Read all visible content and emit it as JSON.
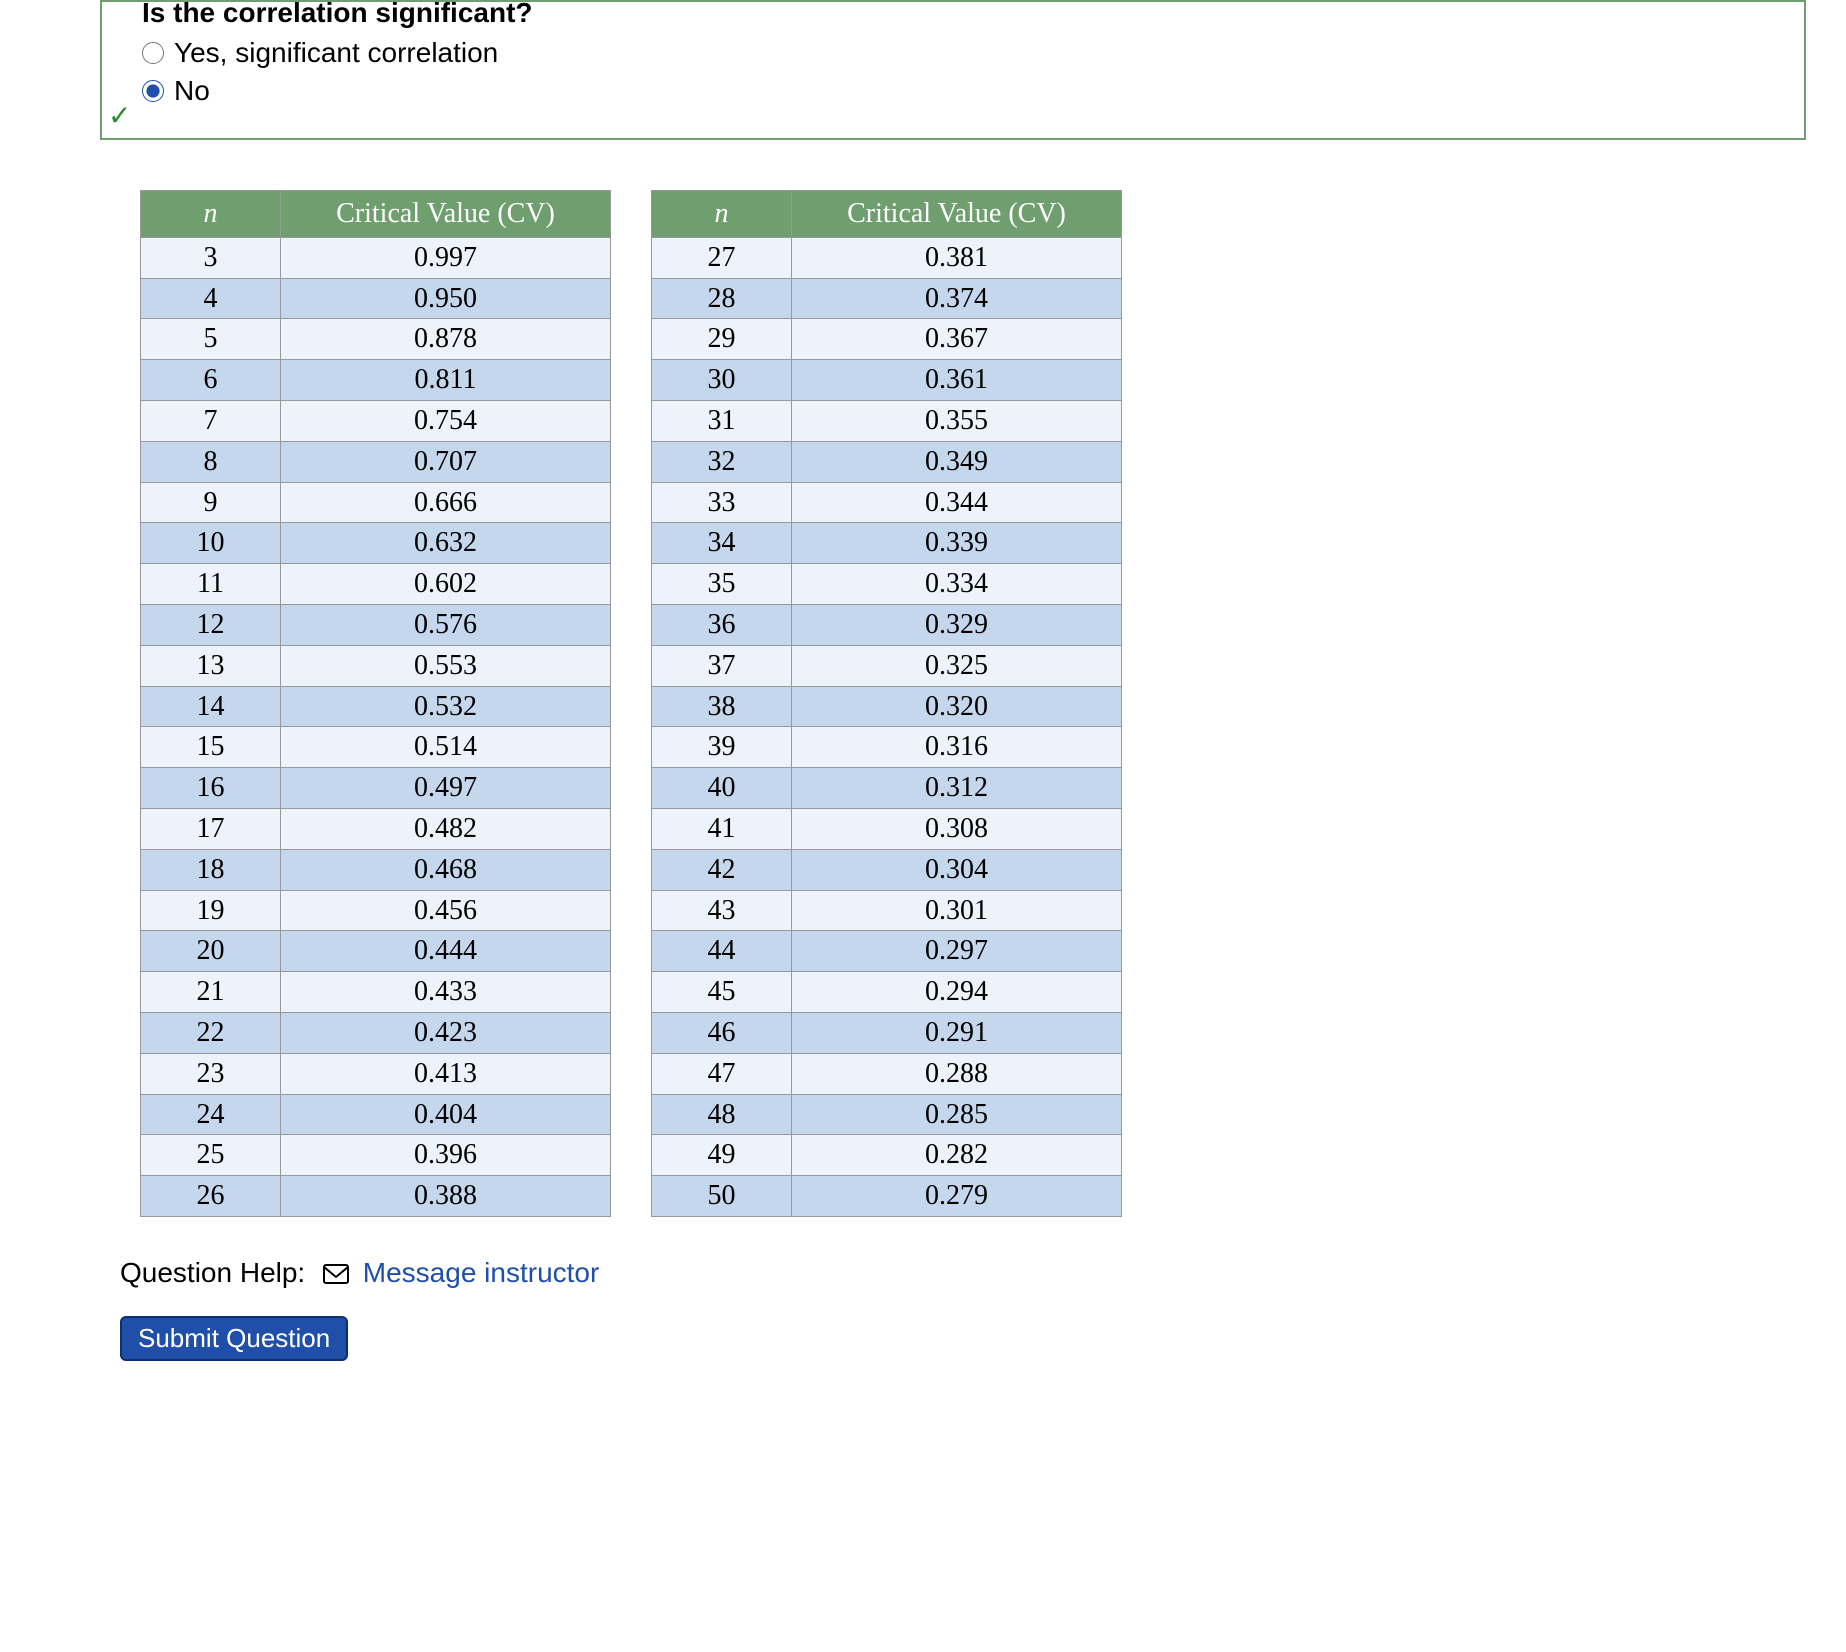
{
  "question": {
    "prompt": "Is the correlation significant?",
    "options": [
      {
        "label": "Yes, significant correlation",
        "checked": false
      },
      {
        "label": "No",
        "checked": true
      }
    ],
    "status_icon": "✓"
  },
  "table_headers": {
    "n": "n",
    "cv": "Critical Value (CV)"
  },
  "table_left": [
    {
      "n": "3",
      "cv": "0.997"
    },
    {
      "n": "4",
      "cv": "0.950"
    },
    {
      "n": "5",
      "cv": "0.878"
    },
    {
      "n": "6",
      "cv": "0.811"
    },
    {
      "n": "7",
      "cv": "0.754"
    },
    {
      "n": "8",
      "cv": "0.707"
    },
    {
      "n": "9",
      "cv": "0.666"
    },
    {
      "n": "10",
      "cv": "0.632"
    },
    {
      "n": "11",
      "cv": "0.602"
    },
    {
      "n": "12",
      "cv": "0.576"
    },
    {
      "n": "13",
      "cv": "0.553"
    },
    {
      "n": "14",
      "cv": "0.532"
    },
    {
      "n": "15",
      "cv": "0.514"
    },
    {
      "n": "16",
      "cv": "0.497"
    },
    {
      "n": "17",
      "cv": "0.482"
    },
    {
      "n": "18",
      "cv": "0.468"
    },
    {
      "n": "19",
      "cv": "0.456"
    },
    {
      "n": "20",
      "cv": "0.444"
    },
    {
      "n": "21",
      "cv": "0.433"
    },
    {
      "n": "22",
      "cv": "0.423"
    },
    {
      "n": "23",
      "cv": "0.413"
    },
    {
      "n": "24",
      "cv": "0.404"
    },
    {
      "n": "25",
      "cv": "0.396"
    },
    {
      "n": "26",
      "cv": "0.388"
    }
  ],
  "table_right": [
    {
      "n": "27",
      "cv": "0.381"
    },
    {
      "n": "28",
      "cv": "0.374"
    },
    {
      "n": "29",
      "cv": "0.367"
    },
    {
      "n": "30",
      "cv": "0.361"
    },
    {
      "n": "31",
      "cv": "0.355"
    },
    {
      "n": "32",
      "cv": "0.349"
    },
    {
      "n": "33",
      "cv": "0.344"
    },
    {
      "n": "34",
      "cv": "0.339"
    },
    {
      "n": "35",
      "cv": "0.334"
    },
    {
      "n": "36",
      "cv": "0.329"
    },
    {
      "n": "37",
      "cv": "0.325"
    },
    {
      "n": "38",
      "cv": "0.320"
    },
    {
      "n": "39",
      "cv": "0.316"
    },
    {
      "n": "40",
      "cv": "0.312"
    },
    {
      "n": "41",
      "cv": "0.308"
    },
    {
      "n": "42",
      "cv": "0.304"
    },
    {
      "n": "43",
      "cv": "0.301"
    },
    {
      "n": "44",
      "cv": "0.297"
    },
    {
      "n": "45",
      "cv": "0.294"
    },
    {
      "n": "46",
      "cv": "0.291"
    },
    {
      "n": "47",
      "cv": "0.288"
    },
    {
      "n": "48",
      "cv": "0.285"
    },
    {
      "n": "49",
      "cv": "0.282"
    },
    {
      "n": "50",
      "cv": "0.279"
    }
  ],
  "help": {
    "label": "Question Help:",
    "link_text": "Message instructor"
  },
  "submit_label": "Submit Question"
}
